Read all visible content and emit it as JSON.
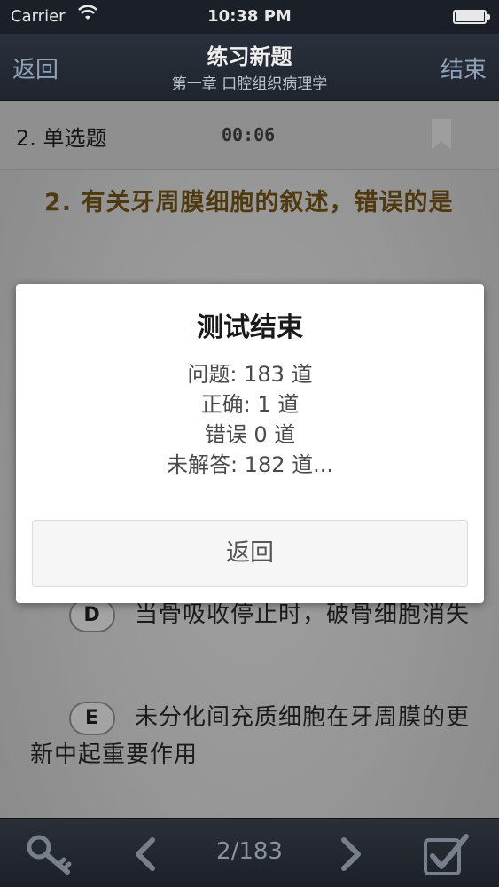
{
  "status_bar": {
    "carrier": "Carrier",
    "time": "10:38 PM"
  },
  "nav": {
    "back": "返回",
    "title": "练习新题",
    "subtitle": "第一章  口腔组织病理学",
    "end": "结束"
  },
  "question": {
    "type": "2. 单选题",
    "timer": "00:06",
    "text": "2. 有关牙周膜细胞的叙述，错误的是",
    "options": [
      {
        "letter": "D",
        "text": "当骨吸收停止时，破骨细胞消失"
      },
      {
        "letter": "E",
        "text": "未分化间充质细胞在牙周膜的更新中起重要作用"
      }
    ]
  },
  "dialog": {
    "title": "测试结束",
    "lines": [
      "问题: 183 道",
      "正确:  1 道",
      "错误 0 道",
      "未解答:   182 道..."
    ],
    "button": "返回"
  },
  "toolbar": {
    "page": "2/183"
  },
  "icons": [
    "wifi-icon",
    "battery-icon",
    "bookmark-icon",
    "key-icon",
    "chevron-left-icon",
    "chevron-right-icon",
    "checkbox-icon"
  ]
}
